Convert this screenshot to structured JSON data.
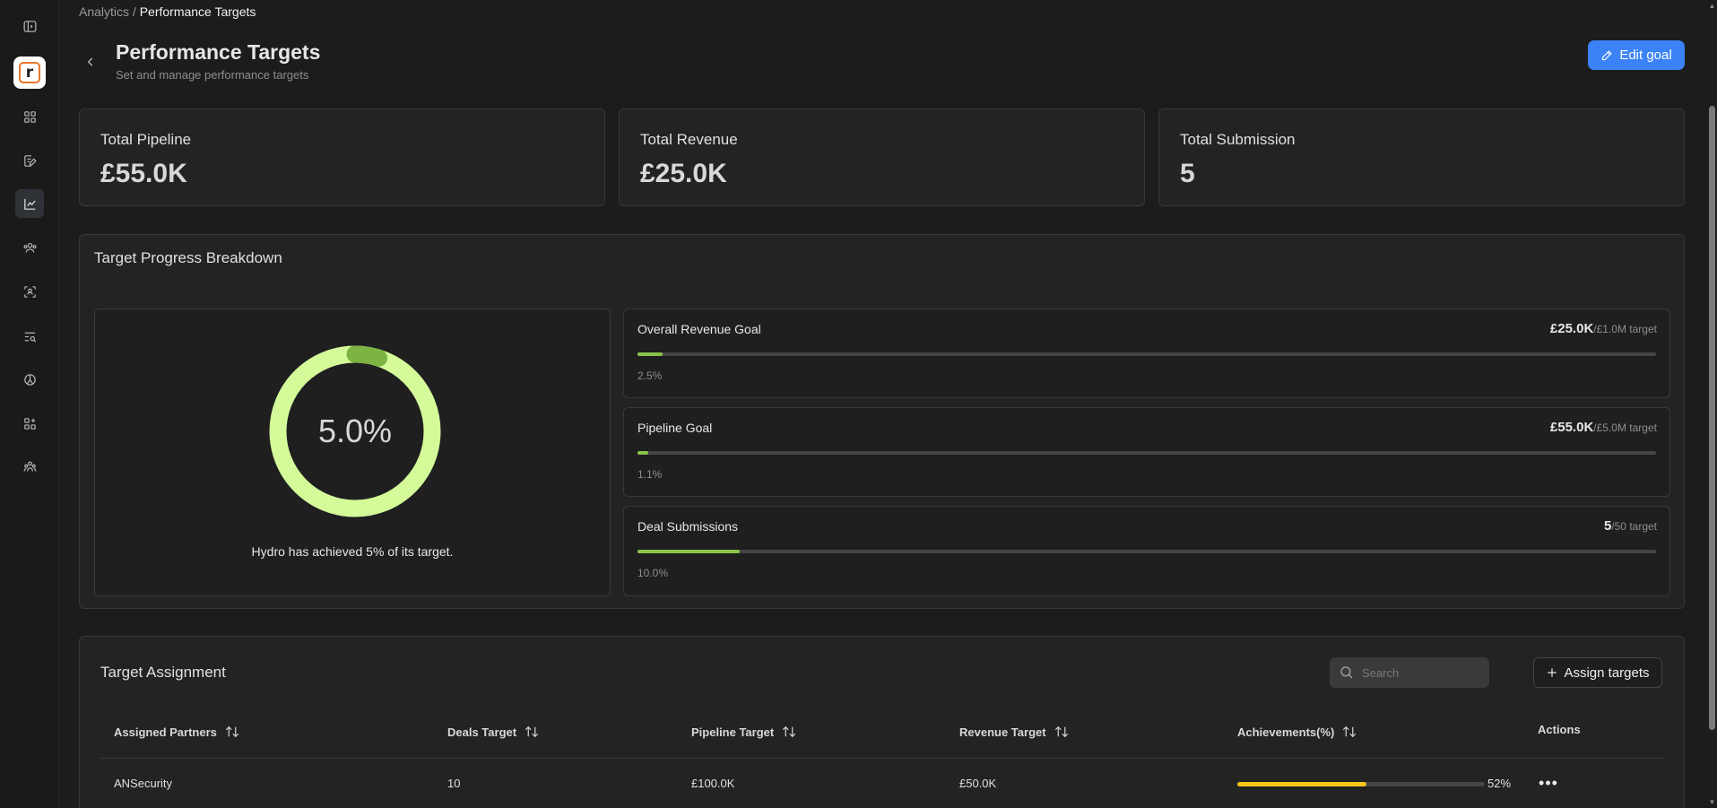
{
  "breadcrumb": {
    "parent": "Analytics",
    "separator": "/",
    "current": "Performance Targets"
  },
  "header": {
    "title": "Performance Targets",
    "subtitle": "Set and manage performance targets",
    "edit_button": "Edit goal"
  },
  "stats": [
    {
      "label": "Total Pipeline",
      "value": "£55.0K"
    },
    {
      "label": "Total Revenue",
      "value": "£25.0K"
    },
    {
      "label": "Total Submission",
      "value": "5"
    }
  ],
  "breakdown": {
    "title": "Target Progress Breakdown",
    "donut_value": "5.0%",
    "donut_fraction": 0.05,
    "caption": "Hydro has achieved 5% of its target.",
    "goals": [
      {
        "label": "Overall Revenue Goal",
        "value": "£25.0K",
        "target": "/£1.0M target",
        "pct_label": "2.5%",
        "fraction": 0.025
      },
      {
        "label": "Pipeline Goal",
        "value": "£55.0K",
        "target": "/£5.0M target",
        "pct_label": "1.1%",
        "fraction": 0.011
      },
      {
        "label": "Deal Submissions",
        "value": "5",
        "target": "/50 target",
        "pct_label": "10.0%",
        "fraction": 0.1
      }
    ]
  },
  "assignment": {
    "title": "Target Assignment",
    "search_placeholder": "Search",
    "assign_button": "Assign targets",
    "columns": [
      "Assigned Partners",
      "Deals Target",
      "Pipeline Target",
      "Revenue Target",
      "Achievements(%)",
      "Actions"
    ],
    "rows": [
      {
        "partner": "ANSecurity",
        "deals": "10",
        "pipeline": "£100.0K",
        "revenue": "£50.0K",
        "achievement": "52%",
        "achievement_fraction": 0.52
      }
    ]
  },
  "colors": {
    "accent": "#3b82f6",
    "progress_green": "#8bc34a",
    "donut_ring": "#d4fa9a",
    "donut_arc": "#7cb342",
    "achievement_yellow": "#f5c518"
  },
  "icons": {
    "sidebar": [
      "sidebar-toggle-icon",
      "dashboard-grid-icon",
      "edit-document-icon",
      "analytics-chart-icon",
      "partners-icon",
      "scan-icon",
      "search-list-icon",
      "pie-icon",
      "apps-add-icon",
      "team-icon"
    ]
  }
}
